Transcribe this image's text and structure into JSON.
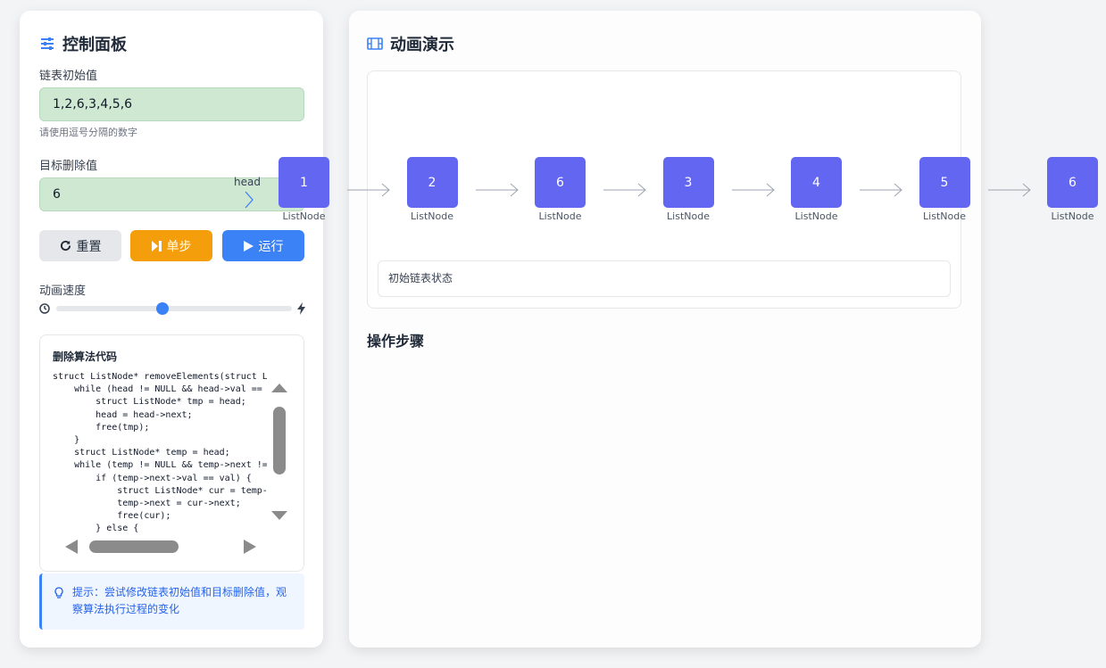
{
  "control": {
    "title": "控制面板",
    "list_label": "链表初始值",
    "list_value": "1,2,6,3,4,5,6",
    "list_hint": "请使用逗号分隔的数字",
    "target_label": "目标删除值",
    "target_value": "6",
    "buttons": {
      "reset": "重置",
      "step": "单步",
      "run": "运行"
    },
    "speed_label": "动画速度",
    "speed_value_percent": 45,
    "code_title": "删除算法代码",
    "code": "struct ListNode* removeElements(struct Li\n    while (head != NULL && head->val == v\n        struct ListNode* tmp = head;\n        head = head->next;\n        free(tmp);\n    }\n    struct ListNode* temp = head;\n    while (temp != NULL && temp->next != N\n        if (temp->next->val == val) {\n            struct ListNode* cur = temp->\n            temp->next = cur->next;\n            free(cur);\n        } else {",
    "tip": "提示：尝试修改链表初始值和目标删除值，观察算法执行过程的变化"
  },
  "demo": {
    "title": "动画演示",
    "status": "初始链表状态",
    "steps_title": "操作步骤",
    "head_label": "head",
    "node_type": "ListNode",
    "nodes": [
      "1",
      "2",
      "6",
      "3",
      "4",
      "5",
      "6"
    ]
  },
  "colors": {
    "node": "#6366f1",
    "input_bg": "#cfe8d2",
    "step_button": "#f59e0b",
    "run_button": "#3b82f6",
    "accent": "#3b82f6"
  },
  "icons": [
    "sliders-icon",
    "film-icon",
    "refresh-icon",
    "step-forward-icon",
    "play-icon",
    "clock-icon",
    "bolt-icon",
    "lightbulb-icon"
  ]
}
